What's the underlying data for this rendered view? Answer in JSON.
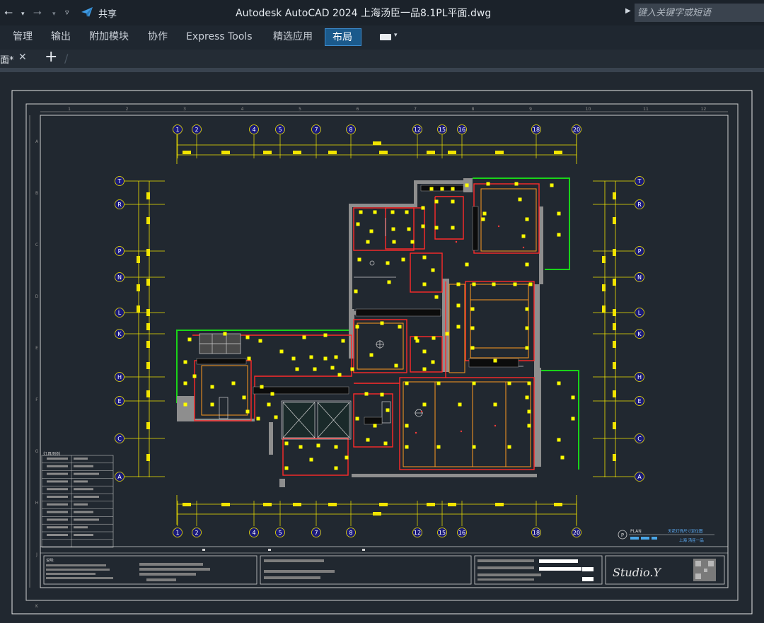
{
  "titlebar": {
    "app_title": "Autodesk AutoCAD 2024    上海汤臣一品8.1PL平面.dwg",
    "share_label": "共享",
    "search_placeholder": "键入关键字或短语",
    "icons": [
      "undo-icon",
      "redo-icon",
      "customize-icon",
      "share-icon",
      "search-expand-icon"
    ]
  },
  "ribbon": {
    "tabs": [
      {
        "label": "管理",
        "active": false
      },
      {
        "label": "输出",
        "active": false
      },
      {
        "label": "附加模块",
        "active": false
      },
      {
        "label": "协作",
        "active": false
      },
      {
        "label": "Express Tools",
        "active": false
      },
      {
        "label": "精选应用",
        "active": false
      },
      {
        "label": "布局",
        "active": true
      }
    ]
  },
  "doctabs": {
    "current": "面*",
    "close_icon": "close-icon",
    "add_icon": "plus-icon"
  },
  "drawing": {
    "grid_top": [
      "1",
      "2",
      "4",
      "5",
      "7",
      "8",
      "12",
      "15",
      "16",
      "18",
      "20"
    ],
    "grid_side": [
      "T",
      "R",
      "P",
      "N",
      "L",
      "K",
      "H",
      "E",
      "C",
      "A"
    ],
    "ruler_top": [
      "1",
      "2",
      "3",
      "4",
      "5",
      "6",
      "7",
      "8",
      "9",
      "10",
      "11",
      "12"
    ],
    "ruler_side": [
      "A",
      "B",
      "C",
      "D",
      "E",
      "F",
      "G",
      "H",
      "J",
      "K"
    ],
    "plan_label": "PLAN",
    "plan_marker": "P",
    "plan_desc": "天花灯饰尺寸定位图",
    "plan_sub": "上海 汤臣一品",
    "studio_logo": "Studio.Y",
    "legend_title": "灯具图例",
    "notes_title": "说明:",
    "colors": {
      "wall": "#ff2a2a",
      "gray_wall": "#9a9a9a",
      "lamp": "#ffff00",
      "glass": "#19d419",
      "dim_line": "#f1e400",
      "axis_bubble": "#1a1a7a",
      "frame": "#d0d0d0",
      "ceiling": "#ff9a1f"
    }
  }
}
